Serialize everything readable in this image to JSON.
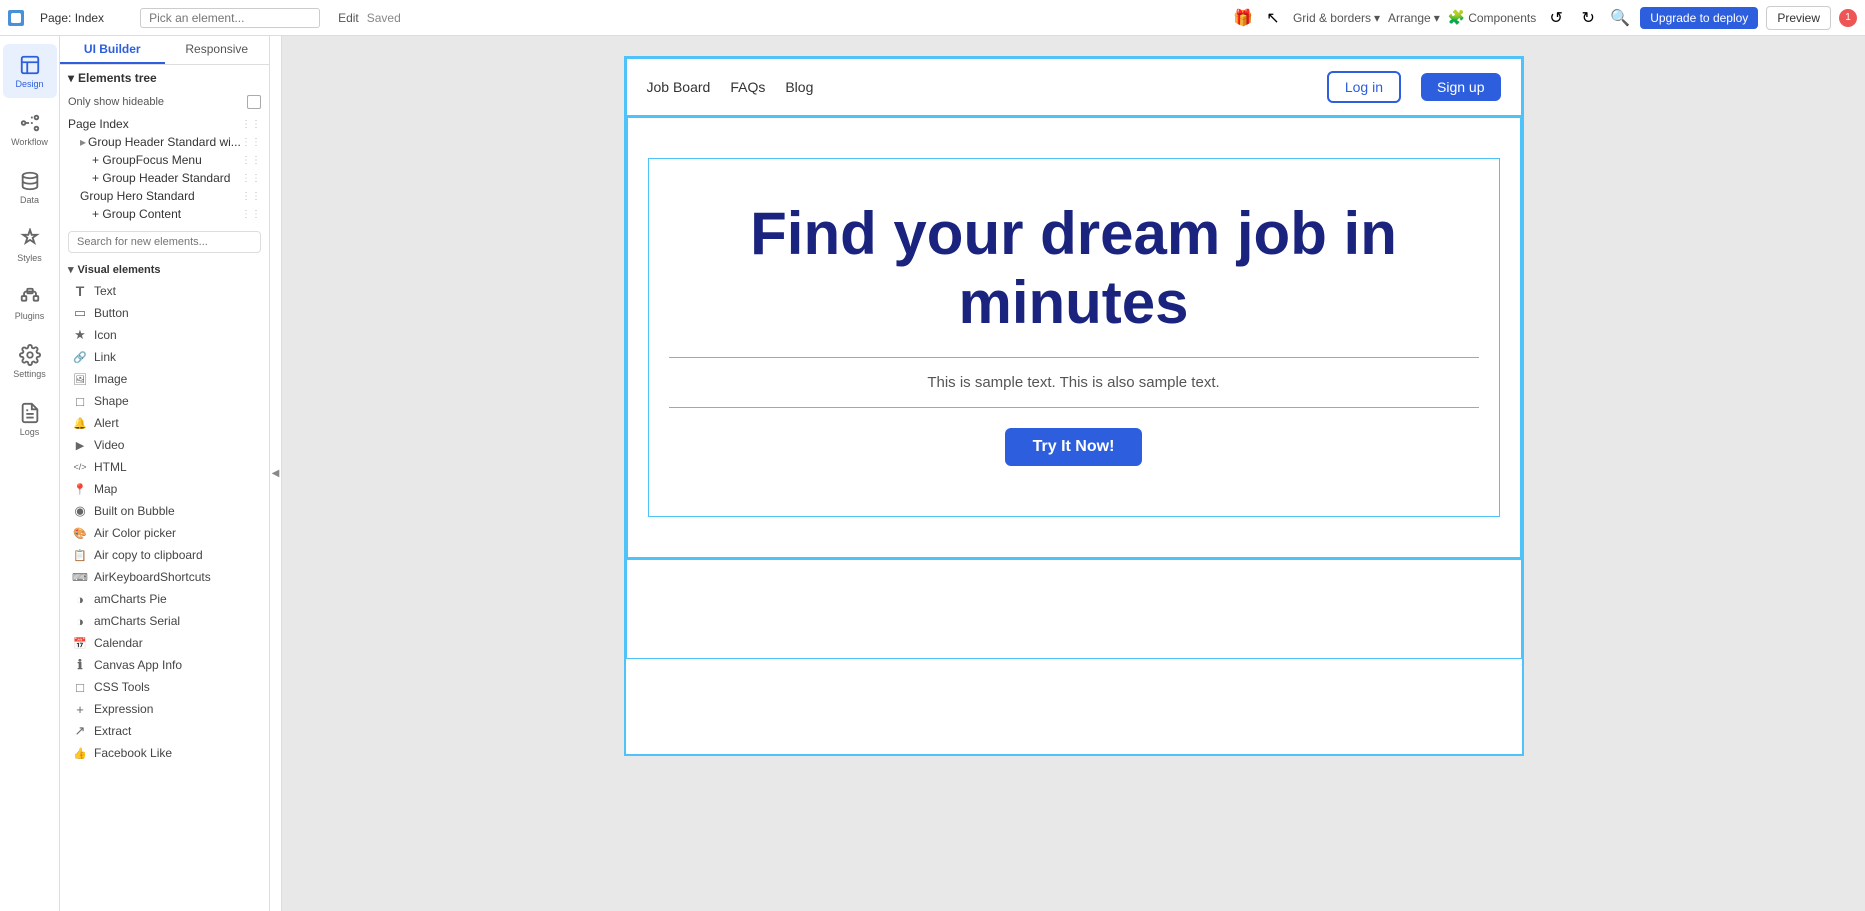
{
  "topbar": {
    "page_label": "Page: Index",
    "pick_placeholder": "Pick an element...",
    "edit_label": "Edit",
    "saved_label": "Saved",
    "grid_label": "Grid & borders",
    "arrange_label": "Arrange",
    "components_label": "Components",
    "upgrade_label": "Upgrade to deploy",
    "preview_label": "Preview"
  },
  "left_panel": {
    "tab_ui_builder": "UI Builder",
    "tab_responsive": "Responsive",
    "elements_tree_label": "Elements tree",
    "only_show_hideable": "Only show hideable",
    "tree_items": [
      {
        "label": "Page Index",
        "indent": 0
      },
      {
        "label": "Group Header Standard wi...",
        "indent": 1
      },
      {
        "label": "GroupFocus Menu",
        "indent": 2
      },
      {
        "label": "Group Header Standard",
        "indent": 2
      },
      {
        "label": "Group Hero Standard",
        "indent": 1
      },
      {
        "label": "Group Content",
        "indent": 2
      }
    ],
    "search_placeholder": "Search for new elements...",
    "visual_elements_label": "Visual elements",
    "elements": [
      {
        "label": "Text",
        "icon": "T"
      },
      {
        "label": "Button",
        "icon": "▭"
      },
      {
        "label": "Icon",
        "icon": "★"
      },
      {
        "label": "Link",
        "icon": "🔗"
      },
      {
        "label": "Image",
        "icon": "🖼"
      },
      {
        "label": "Shape",
        "icon": "□"
      },
      {
        "label": "Alert",
        "icon": "🔔"
      },
      {
        "label": "Video",
        "icon": "▶"
      },
      {
        "label": "HTML",
        "icon": "</>"
      },
      {
        "label": "Map",
        "icon": "📍"
      },
      {
        "label": "Built on Bubble",
        "icon": "◉"
      },
      {
        "label": "Air Color picker",
        "icon": "🎨"
      },
      {
        "label": "Air copy to clipboard",
        "icon": "📋"
      },
      {
        "label": "AirKeyboardShortcuts",
        "icon": "⌨"
      },
      {
        "label": "amCharts Pie",
        "icon": "◑"
      },
      {
        "label": "amCharts Serial",
        "icon": "◑"
      },
      {
        "label": "Calendar",
        "icon": "📅"
      },
      {
        "label": "Canvas App Info",
        "icon": "ℹ"
      },
      {
        "label": "CSS Tools",
        "icon": "□"
      },
      {
        "label": "Expression",
        "icon": "+"
      },
      {
        "label": "Extract",
        "icon": "↗"
      },
      {
        "label": "Facebook Like",
        "icon": "👍"
      }
    ]
  },
  "rail": {
    "items": [
      {
        "label": "Design",
        "active": true
      },
      {
        "label": "Workflow",
        "active": false
      },
      {
        "label": "Data",
        "active": false
      },
      {
        "label": "Styles",
        "active": false
      },
      {
        "label": "Plugins",
        "active": false
      },
      {
        "label": "Settings",
        "active": false
      },
      {
        "label": "Logs",
        "active": false
      }
    ]
  },
  "app_nav": {
    "link1": "Job Board",
    "link2": "FAQs",
    "link3": "Blog",
    "login_label": "Log in",
    "signup_label": "Sign up"
  },
  "hero": {
    "title_line1": "Find your dream job in",
    "title_line2": "minutes",
    "subtitle": "This is sample text. This is also sample text.",
    "cta_label": "Try It Now!"
  }
}
